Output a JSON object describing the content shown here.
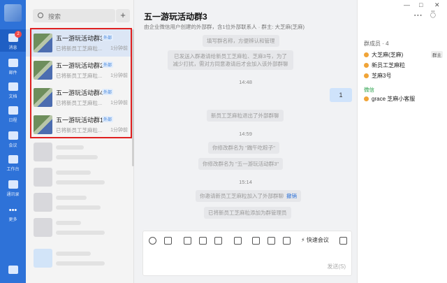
{
  "nav": [
    {
      "label": "消息",
      "badge": "2"
    },
    {
      "label": "邮件"
    },
    {
      "label": "文档"
    },
    {
      "label": "日程"
    },
    {
      "label": "会议"
    },
    {
      "label": "工作台"
    },
    {
      "label": "通讯录"
    },
    {
      "label": "更多"
    }
  ],
  "search": {
    "placeholder": "搜索"
  },
  "conversations": [
    {
      "name": "五一游玩活动群3",
      "tag": "外部",
      "preview": "已将新员工芝麻粒...",
      "time": "1分钟前"
    },
    {
      "name": "五一游玩活动群2",
      "tag": "外部",
      "preview": "已将新员工芝麻粒...",
      "time": "1分钟前"
    },
    {
      "name": "五一游玩活动群4",
      "tag": "外部",
      "preview": "已将新员工芝麻粒...",
      "time": "1分钟前"
    },
    {
      "name": "五一游玩活动群1",
      "tag": "外部",
      "preview": "已将新员工芝麻粒...",
      "time": "1分钟前"
    }
  ],
  "chat": {
    "title": "五一游玩活动群3",
    "description": "由企业微信用户创建的外部群，含1位外部联系人 · 群主: 大芝麻(芝麻)",
    "messages": {
      "top_note": "填写群名称，方便辨认和管理",
      "invite_note": "已发送入群邀请给新员工芝麻粒、芝麻3号，为了减少打扰，需对方同意邀请后才会加入该外部群聊",
      "time1": "14:48",
      "my_msg": "1",
      "left_note": "新员工芝麻粒退出了外部群聊",
      "time2": "14:59",
      "rename1": "你修改群名为 \"踹午吃粽子\"",
      "rename2": "你修改群名为 \"五一游玩活动群3\"",
      "time3": "15:14",
      "invited": "你邀请新员工芝麻粒加入了外部群聊",
      "undo": "撤销",
      "admin": "已将新员工芝麻粒添加为群管理员"
    },
    "toolbar": {
      "quick_meeting": "快速会议"
    },
    "send": "发送(S)"
  },
  "side": {
    "header": "群成员 · 4",
    "members": [
      {
        "name": "大芝麻(芝麻)",
        "role": "群主"
      },
      {
        "name": "新员工芝麻粒"
      },
      {
        "name": "芝麻3号"
      }
    ],
    "wechat_label": "微信",
    "wechat_member": "grace 芝麻小客服"
  }
}
